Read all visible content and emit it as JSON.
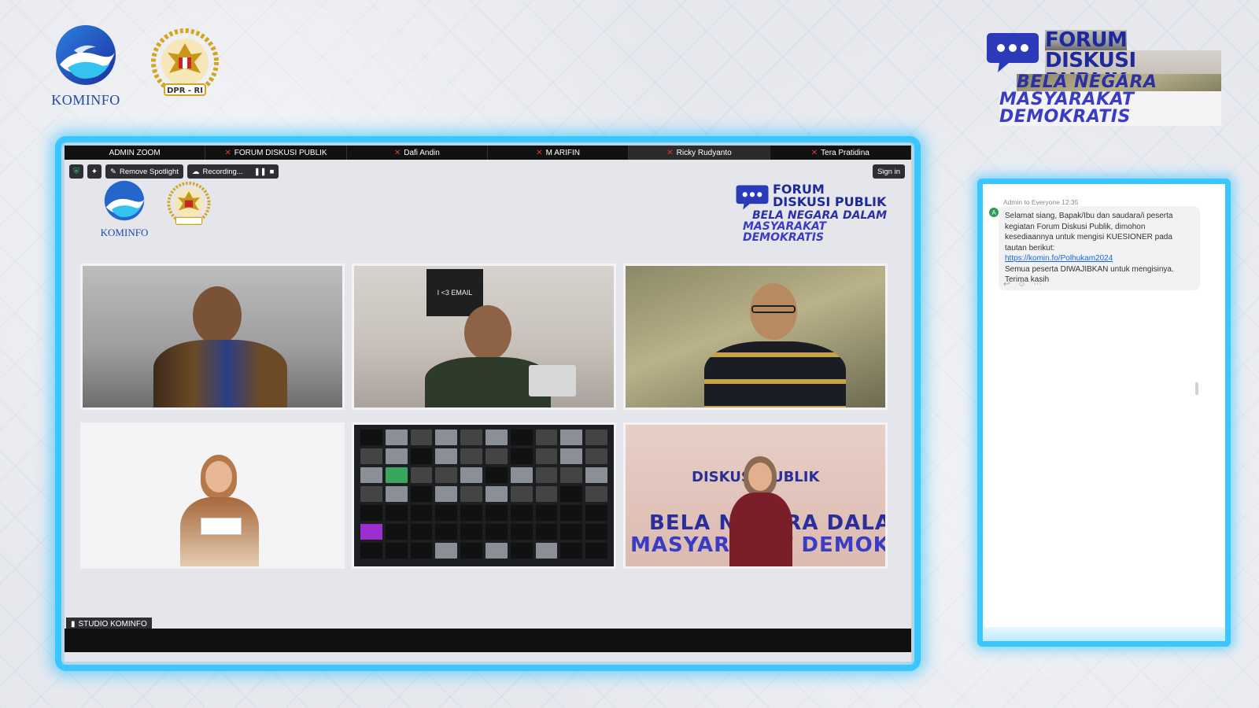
{
  "brand": {
    "kominfo": "KOMINFO",
    "dpr": "DPR-RI",
    "forum_line1": "FORUM",
    "forum_line2": "DISKUSI PUBLIK",
    "theme_line1": "BELA NEGARA DALAM",
    "theme_line2": "MASYARAKAT DEMOKRATIS"
  },
  "zoom": {
    "participants": [
      {
        "name": "ADMIN ZOOM",
        "muted": false
      },
      {
        "name": "FORUM DISKUSI PUBLIK",
        "muted": true
      },
      {
        "name": "Dafi Andin",
        "muted": true
      },
      {
        "name": "M ARIFIN",
        "muted": true
      },
      {
        "name": "Ricky Rudyanto",
        "muted": true
      },
      {
        "name": "Tera Pratidina",
        "muted": true
      }
    ],
    "toolbar": {
      "remove_spotlight": "Remove Spotlight",
      "recording": "Recording...",
      "sign_in": "Sign in"
    },
    "studio_label": "STUDIO KOMINFO",
    "board_text": "I <3 EMAIL"
  },
  "chat": {
    "from": "Admin to Everyone 12:35",
    "avatar_initial": "A",
    "message_part1": "Selamat siang, Bapak/Ibu dan saudara/i peserta kegiatan Forum Diskusi Publik, dimohon kesediaannya untuk mengisi KUESIONER pada tautan berikut:",
    "link": "https://komin.fo/Polhukam2024",
    "message_part2": "Semua peserta DIWAJIBKAN untuk mengisinya. Terima kasih"
  },
  "colors": {
    "frame_glow": "#3cc6ff",
    "brand_navy": "#1e2a9c",
    "kominfo_blue": "#1f4aa8",
    "mic_red": "#e53935"
  }
}
